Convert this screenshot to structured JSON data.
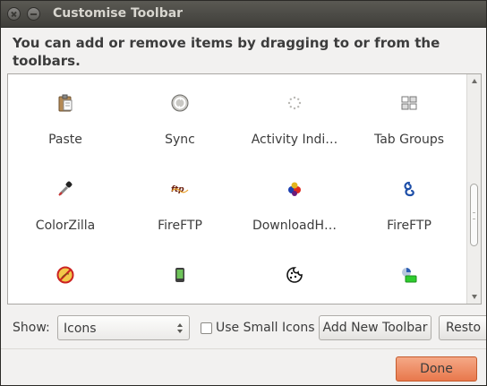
{
  "window": {
    "title": "Customise Toolbar"
  },
  "instructions": "You can add or remove items by dragging to or from the toolbars.",
  "palette": {
    "items": [
      {
        "label": "Paste",
        "icon": "clipboard-icon"
      },
      {
        "label": "Sync",
        "icon": "sync-icon"
      },
      {
        "label": "Activity Indi…",
        "icon": "spinner-icon"
      },
      {
        "label": "Tab Groups",
        "icon": "tab-groups-icon"
      },
      {
        "label": "ColorZilla",
        "icon": "eyedropper-icon"
      },
      {
        "label": "FireFTP",
        "icon": "fireftp-text-icon"
      },
      {
        "label": "DownloadH…",
        "icon": "download-helper-icon"
      },
      {
        "label": "FireFTP",
        "icon": "fireftp-swirl-icon"
      },
      {
        "label": "",
        "icon": "no-flash-icon"
      },
      {
        "label": "",
        "icon": "phone-icon"
      },
      {
        "label": "",
        "icon": "cookie-icon"
      },
      {
        "label": "",
        "icon": "pie-battery-icon"
      }
    ]
  },
  "controls": {
    "show_label": "Show:",
    "show_value": "Icons",
    "small_icons_label": "Use Small Icons",
    "small_icons_checked": false,
    "add_toolbar_label": "Add New Toolbar",
    "restore_label": "Resto",
    "done_label": "Done"
  },
  "colors": {
    "accent": "#e8784c",
    "titlebar": "#4a4945"
  }
}
